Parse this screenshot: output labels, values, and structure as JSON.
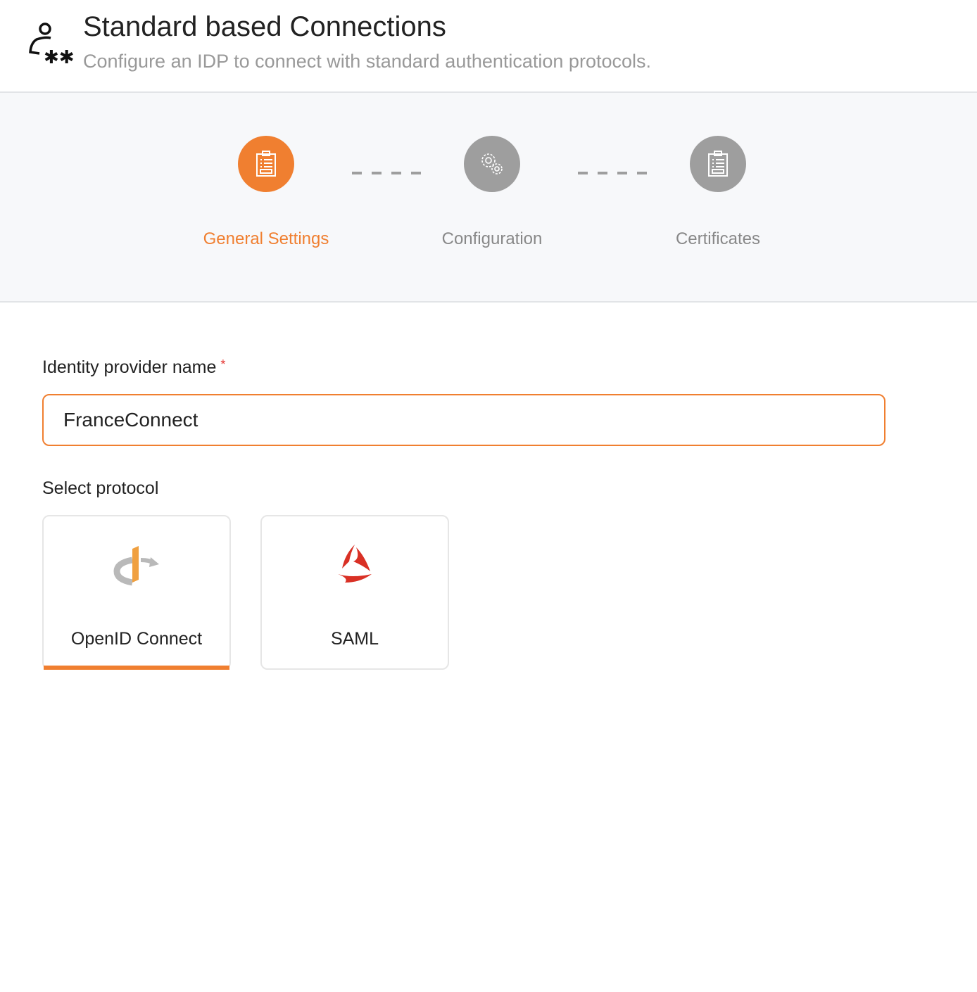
{
  "header": {
    "icon": "user-key-icon",
    "title": "Standard based Connections",
    "subtitle": "Configure an IDP to connect with standard authentication protocols."
  },
  "stepper": {
    "steps": [
      {
        "label": "General Settings",
        "icon": "clipboard-icon",
        "state": "active",
        "color": "#f07f30"
      },
      {
        "label": "Configuration",
        "icon": "gears-icon",
        "state": "inactive",
        "color": "#9e9e9e"
      },
      {
        "label": "Certificates",
        "icon": "clipboard-icon",
        "state": "inactive",
        "color": "#9e9e9e"
      }
    ]
  },
  "form": {
    "idp_name_label": "Identity provider name",
    "required_mark": "*",
    "idp_name_value": "FranceConnect",
    "protocol_label": "Select protocol",
    "protocols": [
      {
        "label": "OpenID Connect",
        "icon": "openid-icon",
        "selected": true
      },
      {
        "label": "SAML",
        "icon": "saml-icon",
        "selected": false
      }
    ]
  },
  "colors": {
    "accent": "#f07f30",
    "inactive": "#9e9e9e"
  }
}
